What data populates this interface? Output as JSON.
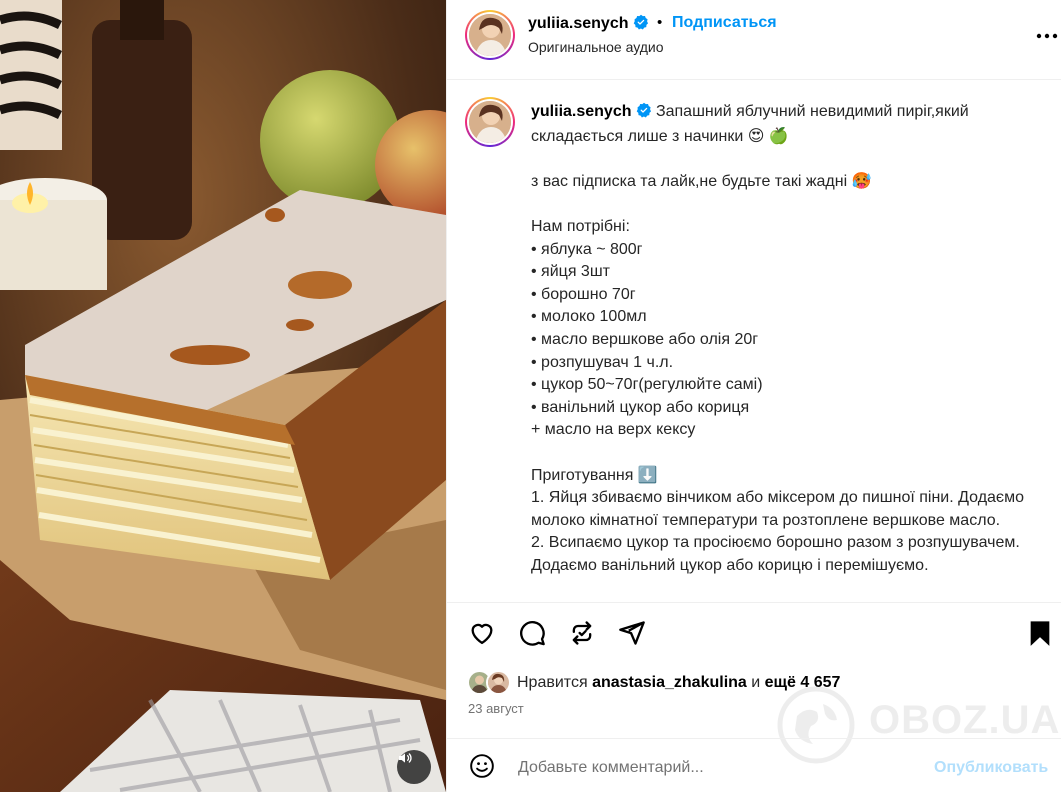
{
  "post": {
    "username": "yuliia.senych",
    "follow_label": "Подписаться",
    "separator": "•",
    "audio_label": "Оригинальное аудио",
    "caption": {
      "username": "yuliia.senych",
      "text": "Запашний яблучний невидимий пиріг,який складається лише з начинки 😍 🍏\n\nз вас підписка та лайк,не будьте такі жадні 🥵\n\nНам потрібні:\n• яблука ~ 800г\n• яйця 3шт\n• борошно 70г\n• молоко 100мл\n• масло вершкове або олія 20г\n• розпушувач 1 ч.л.\n• цукор 50~70г(регулюйте самі)\n• ванільний цукор або кориця\n+ масло на верх кексу\n\nПриготування ⬇️\n1. Яйця збиваємо вінчиком або міксером до пишної піни. Додаємо молоко кімнатної температури та розтоплене вершкове масло.\n2. Всипаємо цукор та просіюємо борошно разом з розпушувачем. Додаємо ванільний цукор або корицю і перемішуємо."
    },
    "likes": {
      "prefix": "Нравится",
      "user": "anastasia_zhakulina",
      "middle": "и",
      "rest": "ещё 4 657"
    },
    "date": "23 август"
  },
  "comment": {
    "placeholder": "Добавьте комментарий...",
    "post_label": "Опубликовать"
  },
  "watermark": "OBOZ.UA",
  "colors": {
    "accent": "#0095f6",
    "post_disabled": "#b2dffc",
    "verified": "#0095f6"
  },
  "icons": [
    "more-icon",
    "heart-icon",
    "comment-icon",
    "repost-icon",
    "share-icon",
    "bookmark-icon",
    "emoji-icon",
    "speaker-icon",
    "verified-icon"
  ]
}
